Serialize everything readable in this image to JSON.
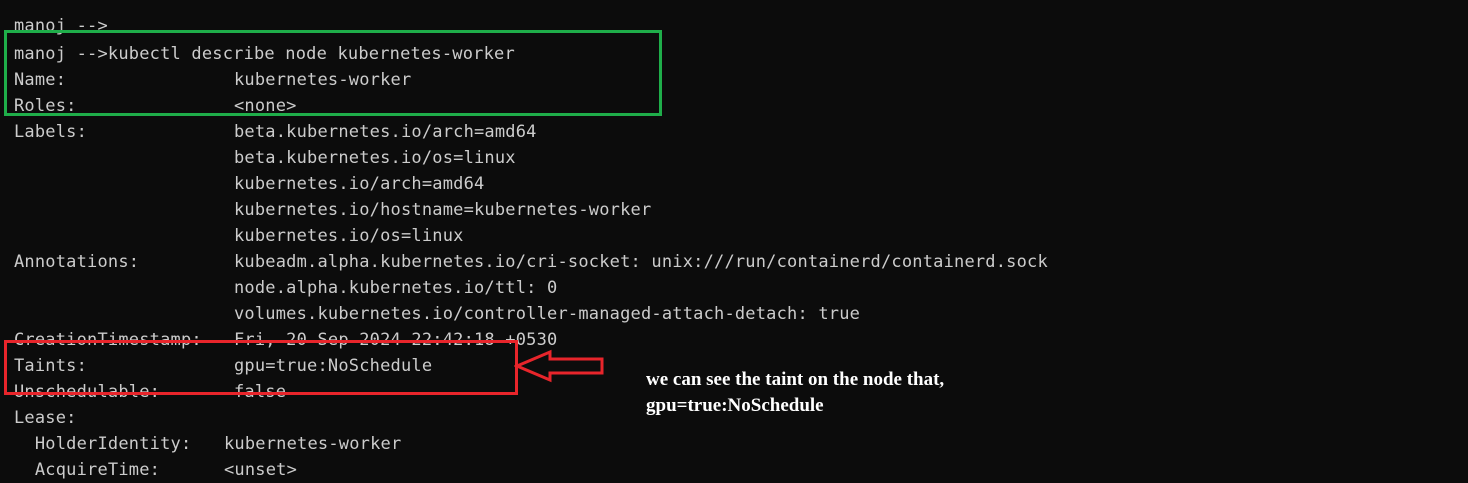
{
  "colors": {
    "background": "#0c0c0c",
    "text": "#cccccc",
    "highlight_green": "#1fae4a",
    "highlight_red": "#e8252b",
    "annotation_text": "#ffffff"
  },
  "terminal": {
    "lines": [
      {
        "label": "manoj -->",
        "value": ""
      },
      {
        "label": "manoj -->kubectl describe node kubernetes-worker",
        "value": ""
      },
      {
        "label": "Name:",
        "value": "kubernetes-worker"
      },
      {
        "label": "Roles:",
        "value": "<none>"
      },
      {
        "label": "Labels:",
        "value": "beta.kubernetes.io/arch=amd64"
      },
      {
        "label": "",
        "value": "beta.kubernetes.io/os=linux"
      },
      {
        "label": "",
        "value": "kubernetes.io/arch=amd64"
      },
      {
        "label": "",
        "value": "kubernetes.io/hostname=kubernetes-worker"
      },
      {
        "label": "",
        "value": "kubernetes.io/os=linux"
      },
      {
        "label": "Annotations:",
        "value": "kubeadm.alpha.kubernetes.io/cri-socket: unix:///run/containerd/containerd.sock"
      },
      {
        "label": "",
        "value": "node.alpha.kubernetes.io/ttl: 0"
      },
      {
        "label": "",
        "value": "volumes.kubernetes.io/controller-managed-attach-detach: true"
      },
      {
        "label": "CreationTimestamp:",
        "value": "Fri, 20 Sep 2024 22:42:18 +0530"
      },
      {
        "label": "Taints:",
        "value": "gpu=true:NoSchedule"
      },
      {
        "label": "Unschedulable:",
        "value": "false"
      },
      {
        "label": "Lease:",
        "value": ""
      },
      {
        "label": "  HolderIdentity:",
        "value": "kubernetes-worker"
      },
      {
        "label": "  AcquireTime:",
        "value": "<unset>"
      }
    ]
  },
  "annotation": {
    "line1": "we can see the taint on the node that,",
    "line2": "gpu=true:NoSchedule"
  }
}
